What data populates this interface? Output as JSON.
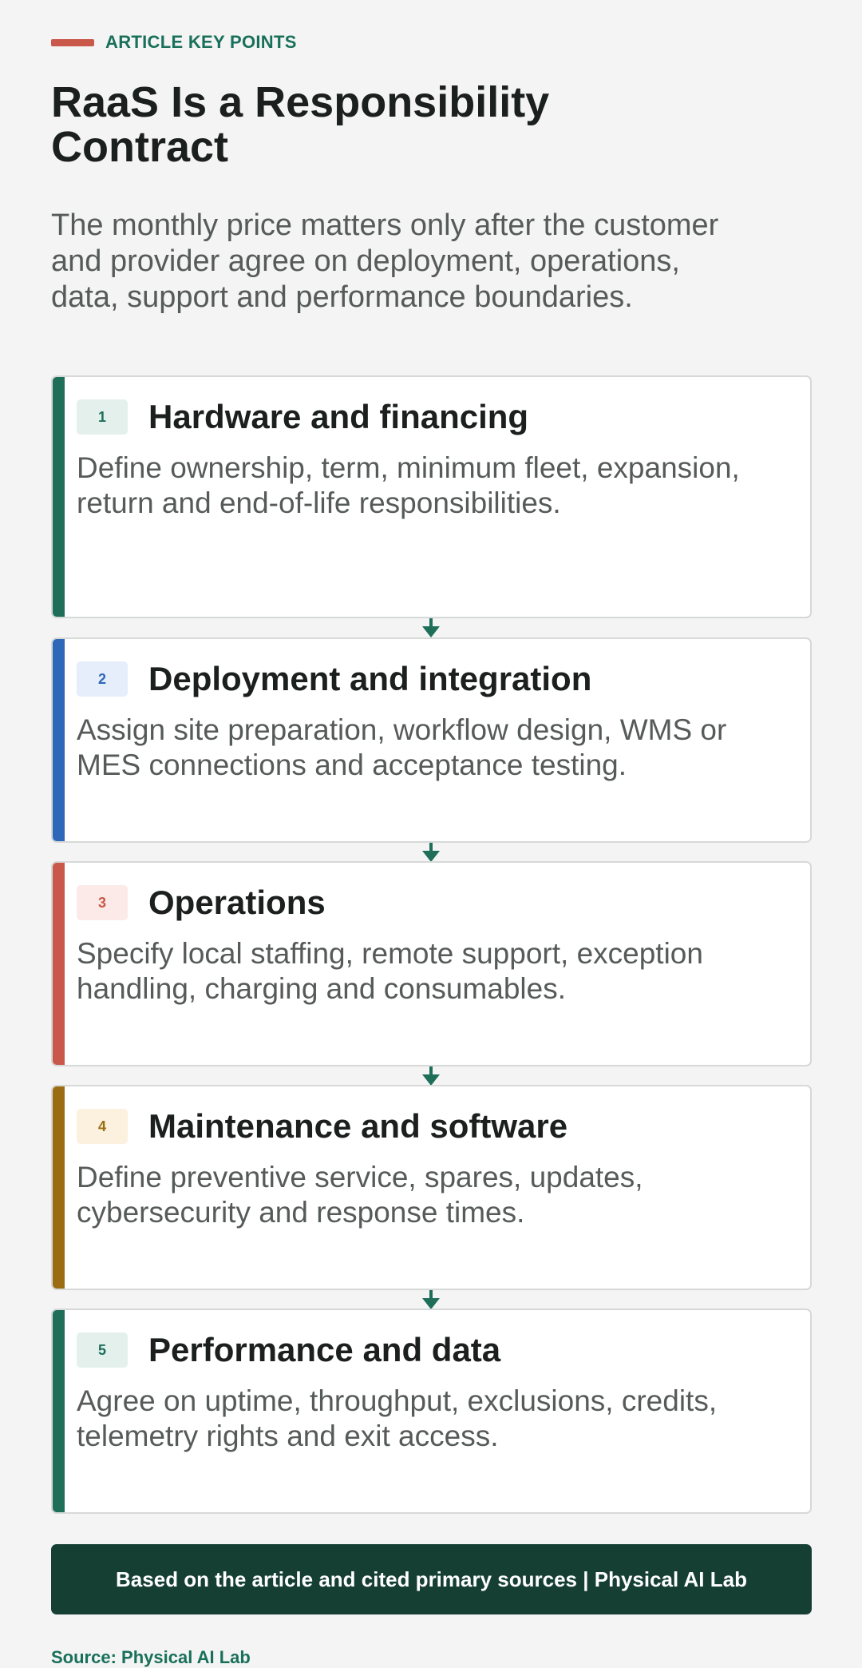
{
  "header": {
    "eyebrow": "ARTICLE KEY POINTS",
    "title": "RaaS Is a Responsibility Contract",
    "subtitle": "The monthly price matters only after the customer and provider agree on deployment, operations, data, support and performance boundaries."
  },
  "colors": {
    "accent_red": "#c9574a",
    "brand_green": "#19705a",
    "footer_bg": "#163f34"
  },
  "steps": [
    {
      "number": "1",
      "title": "Hardware and financing",
      "description": "Define ownership, term, minimum fleet, expansion, return and end-of-life responsibilities.",
      "accent": "#1e6e5a",
      "badge_bg": "#e4f0ec",
      "badge_fg": "#1e6e5a"
    },
    {
      "number": "2",
      "title": "Deployment and integration",
      "description": "Assign site preparation, workflow design, WMS or MES connections and acceptance testing.",
      "accent": "#2e68b8",
      "badge_bg": "#e5eefa",
      "badge_fg": "#2e68b8"
    },
    {
      "number": "3",
      "title": "Operations",
      "description": "Specify local staffing, remote support, exception handling, charging and consumables.",
      "accent": "#c9574a",
      "badge_bg": "#fbeae7",
      "badge_fg": "#c9574a"
    },
    {
      "number": "4",
      "title": "Maintenance and software",
      "description": "Define preventive service, spares, updates, cybersecurity and response times.",
      "accent": "#9c6c12",
      "badge_bg": "#fbf1de",
      "badge_fg": "#9c6c12"
    },
    {
      "number": "5",
      "title": "Performance and data",
      "description": "Agree on uptime, throughput, exclusions, credits, telemetry rights and exit access.",
      "accent": "#1e6e5a",
      "badge_bg": "#e4f0ec",
      "badge_fg": "#1e6e5a"
    }
  ],
  "footer": {
    "banner": "Based on the article and cited primary sources | Physical AI Lab",
    "source": "Source: Physical AI Lab"
  }
}
